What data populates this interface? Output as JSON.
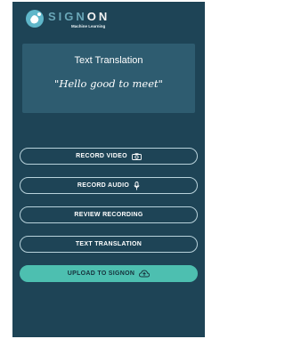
{
  "app": {
    "logo_word_left": "SIGN",
    "logo_word_right": "ON",
    "logo_subtitle": "Machine Learning"
  },
  "card": {
    "title": "Text Translation",
    "quote": "\"Hello good to meet\""
  },
  "buttons": {
    "record_video": "RECORD VIDEO",
    "record_audio": "RECORD AUDIO",
    "review_recording": "REVIEW RECORDING",
    "text_translation": "TEXT TRANSLATION",
    "upload": "UPLOAD TO SIGNON"
  },
  "icons": {
    "record_video": "camera-icon",
    "record_audio": "microphone-icon",
    "upload": "cloud-upload-icon"
  },
  "colors": {
    "background": "#1e4456",
    "card": "#2e5c70",
    "accent": "#4dbfb0",
    "button_border": "#b8d2db"
  }
}
